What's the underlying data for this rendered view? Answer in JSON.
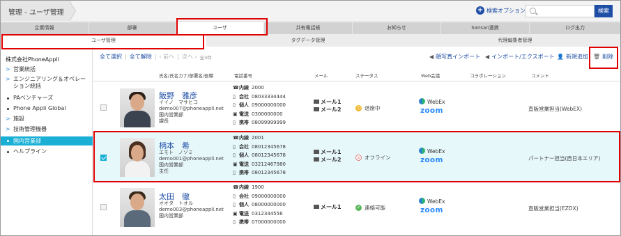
{
  "header": {
    "breadcrumb": "管理 - ユーザ管理",
    "search_option": "検索オプション",
    "search_placeholder": "",
    "search_button": "検索"
  },
  "tabs": [
    "企業情報",
    "部署",
    "ユーザ",
    "共有電話帳",
    "お知らせ",
    "Sansan連携",
    "ログ出力"
  ],
  "active_tab": "ユーザ",
  "subtabs": [
    "ユーザ管理",
    "タグデータ管理",
    "代理編集者管理"
  ],
  "active_subtab": "ユーザ管理",
  "sidebar": {
    "company": "株式会社PhoneAppli",
    "items": [
      {
        "label": "営業統括",
        "type": "folder"
      },
      {
        "label": "エンジニアリング＆オペレー\nション統括",
        "type": "folder"
      },
      {
        "label": "PAベンチャーズ",
        "type": "leaf"
      },
      {
        "label": "Phone Appli Global",
        "type": "leaf"
      },
      {
        "label": "施設",
        "type": "folder"
      },
      {
        "label": "技術管理機器",
        "type": "folder"
      },
      {
        "label": "国内営業部",
        "type": "leaf",
        "active": true
      },
      {
        "label": "ヘルプライン",
        "type": "leaf"
      }
    ]
  },
  "toolbar": {
    "select_all": "全て選択",
    "clear_all": "全て解除",
    "prev": "前へ",
    "next": "次へ",
    "count": "全3件",
    "photo_import": "顔写真インポート",
    "import_export": "インポート/エクスポート",
    "add_new": "新規追加",
    "delete": "削除"
  },
  "columns": [
    "氏名/氏名カナ/部署名/役職",
    "電話番号",
    "メール",
    "ステータス",
    "Web会議",
    "コラボレーション",
    "コメント"
  ],
  "phone_labels": [
    "内線",
    "会社",
    "個人",
    "電送",
    "携帯"
  ],
  "users": [
    {
      "checked": false,
      "name": "飯野　雅彦",
      "kana": "イイノ　マサヒコ",
      "email": "demo007@phoneappli.net",
      "dept": "国内営業部",
      "title": "課長",
      "phones": [
        "2000",
        "08033334444",
        "09000000000",
        "0300000000",
        "08099999999"
      ],
      "mails": [
        "メール1",
        "メール2"
      ],
      "status": "退席中",
      "status_color": "#f0b323",
      "webex": "WebEx",
      "zoom": "zoom",
      "comment": "直販営業担当(WebEX)"
    },
    {
      "checked": true,
      "name": "柄本　希",
      "kana": "エモト　ノゾミ",
      "email": "demo001@phoneappli.net",
      "dept": "国内営業部",
      "title": "主任",
      "phones": [
        "2001",
        "08012345678",
        "08012345678",
        "03212467980",
        "08012345678"
      ],
      "mails": [
        "メール1",
        "メール2"
      ],
      "status": "オフライン",
      "status_color": "#e07a7a",
      "webex": "WebEx",
      "zoom": "zoom",
      "comment": "パートナー担当(西日本エリア)"
    },
    {
      "checked": false,
      "name": "太田　徹",
      "kana": "オオタ　トオル",
      "email": "demo003@phoneappli.net",
      "dept": "国内営業部",
      "title": "",
      "phones": [
        "1900",
        "09000000000",
        "08000000000",
        "0312344556",
        "07000000000"
      ],
      "mails": [
        "メール1"
      ],
      "status": "連絡可能",
      "status_color": "#5cb85c",
      "webex": "WebEx",
      "zoom": "zoom",
      "comment": "直販営業担当(EZDX)"
    }
  ]
}
